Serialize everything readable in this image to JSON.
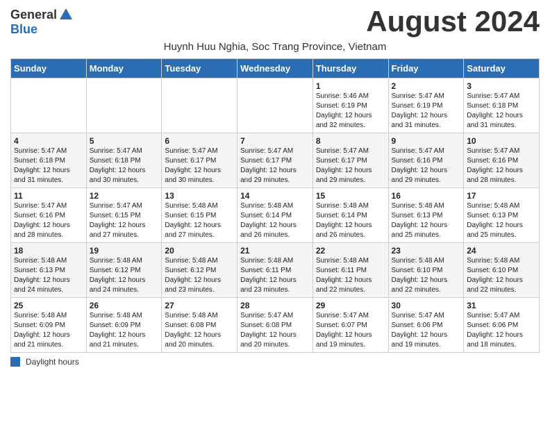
{
  "header": {
    "logo_general": "General",
    "logo_blue": "Blue",
    "month_title": "August 2024",
    "subtitle": "Huynh Huu Nghia, Soc Trang Province, Vietnam"
  },
  "days_of_week": [
    "Sunday",
    "Monday",
    "Tuesday",
    "Wednesday",
    "Thursday",
    "Friday",
    "Saturday"
  ],
  "legend": {
    "label": "Daylight hours"
  },
  "weeks": [
    [
      {
        "day": "",
        "info": ""
      },
      {
        "day": "",
        "info": ""
      },
      {
        "day": "",
        "info": ""
      },
      {
        "day": "",
        "info": ""
      },
      {
        "day": "1",
        "info": "Sunrise: 5:46 AM\nSunset: 6:19 PM\nDaylight: 12 hours\nand 32 minutes."
      },
      {
        "day": "2",
        "info": "Sunrise: 5:47 AM\nSunset: 6:19 PM\nDaylight: 12 hours\nand 31 minutes."
      },
      {
        "day": "3",
        "info": "Sunrise: 5:47 AM\nSunset: 6:18 PM\nDaylight: 12 hours\nand 31 minutes."
      }
    ],
    [
      {
        "day": "4",
        "info": "Sunrise: 5:47 AM\nSunset: 6:18 PM\nDaylight: 12 hours\nand 31 minutes."
      },
      {
        "day": "5",
        "info": "Sunrise: 5:47 AM\nSunset: 6:18 PM\nDaylight: 12 hours\nand 30 minutes."
      },
      {
        "day": "6",
        "info": "Sunrise: 5:47 AM\nSunset: 6:17 PM\nDaylight: 12 hours\nand 30 minutes."
      },
      {
        "day": "7",
        "info": "Sunrise: 5:47 AM\nSunset: 6:17 PM\nDaylight: 12 hours\nand 29 minutes."
      },
      {
        "day": "8",
        "info": "Sunrise: 5:47 AM\nSunset: 6:17 PM\nDaylight: 12 hours\nand 29 minutes."
      },
      {
        "day": "9",
        "info": "Sunrise: 5:47 AM\nSunset: 6:16 PM\nDaylight: 12 hours\nand 29 minutes."
      },
      {
        "day": "10",
        "info": "Sunrise: 5:47 AM\nSunset: 6:16 PM\nDaylight: 12 hours\nand 28 minutes."
      }
    ],
    [
      {
        "day": "11",
        "info": "Sunrise: 5:47 AM\nSunset: 6:16 PM\nDaylight: 12 hours\nand 28 minutes."
      },
      {
        "day": "12",
        "info": "Sunrise: 5:47 AM\nSunset: 6:15 PM\nDaylight: 12 hours\nand 27 minutes."
      },
      {
        "day": "13",
        "info": "Sunrise: 5:48 AM\nSunset: 6:15 PM\nDaylight: 12 hours\nand 27 minutes."
      },
      {
        "day": "14",
        "info": "Sunrise: 5:48 AM\nSunset: 6:14 PM\nDaylight: 12 hours\nand 26 minutes."
      },
      {
        "day": "15",
        "info": "Sunrise: 5:48 AM\nSunset: 6:14 PM\nDaylight: 12 hours\nand 26 minutes."
      },
      {
        "day": "16",
        "info": "Sunrise: 5:48 AM\nSunset: 6:13 PM\nDaylight: 12 hours\nand 25 minutes."
      },
      {
        "day": "17",
        "info": "Sunrise: 5:48 AM\nSunset: 6:13 PM\nDaylight: 12 hours\nand 25 minutes."
      }
    ],
    [
      {
        "day": "18",
        "info": "Sunrise: 5:48 AM\nSunset: 6:13 PM\nDaylight: 12 hours\nand 24 minutes."
      },
      {
        "day": "19",
        "info": "Sunrise: 5:48 AM\nSunset: 6:12 PM\nDaylight: 12 hours\nand 24 minutes."
      },
      {
        "day": "20",
        "info": "Sunrise: 5:48 AM\nSunset: 6:12 PM\nDaylight: 12 hours\nand 23 minutes."
      },
      {
        "day": "21",
        "info": "Sunrise: 5:48 AM\nSunset: 6:11 PM\nDaylight: 12 hours\nand 23 minutes."
      },
      {
        "day": "22",
        "info": "Sunrise: 5:48 AM\nSunset: 6:11 PM\nDaylight: 12 hours\nand 22 minutes."
      },
      {
        "day": "23",
        "info": "Sunrise: 5:48 AM\nSunset: 6:10 PM\nDaylight: 12 hours\nand 22 minutes."
      },
      {
        "day": "24",
        "info": "Sunrise: 5:48 AM\nSunset: 6:10 PM\nDaylight: 12 hours\nand 22 minutes."
      }
    ],
    [
      {
        "day": "25",
        "info": "Sunrise: 5:48 AM\nSunset: 6:09 PM\nDaylight: 12 hours\nand 21 minutes."
      },
      {
        "day": "26",
        "info": "Sunrise: 5:48 AM\nSunset: 6:09 PM\nDaylight: 12 hours\nand 21 minutes."
      },
      {
        "day": "27",
        "info": "Sunrise: 5:48 AM\nSunset: 6:08 PM\nDaylight: 12 hours\nand 20 minutes."
      },
      {
        "day": "28",
        "info": "Sunrise: 5:47 AM\nSunset: 6:08 PM\nDaylight: 12 hours\nand 20 minutes."
      },
      {
        "day": "29",
        "info": "Sunrise: 5:47 AM\nSunset: 6:07 PM\nDaylight: 12 hours\nand 19 minutes."
      },
      {
        "day": "30",
        "info": "Sunrise: 5:47 AM\nSunset: 6:06 PM\nDaylight: 12 hours\nand 19 minutes."
      },
      {
        "day": "31",
        "info": "Sunrise: 5:47 AM\nSunset: 6:06 PM\nDaylight: 12 hours\nand 18 minutes."
      }
    ]
  ]
}
